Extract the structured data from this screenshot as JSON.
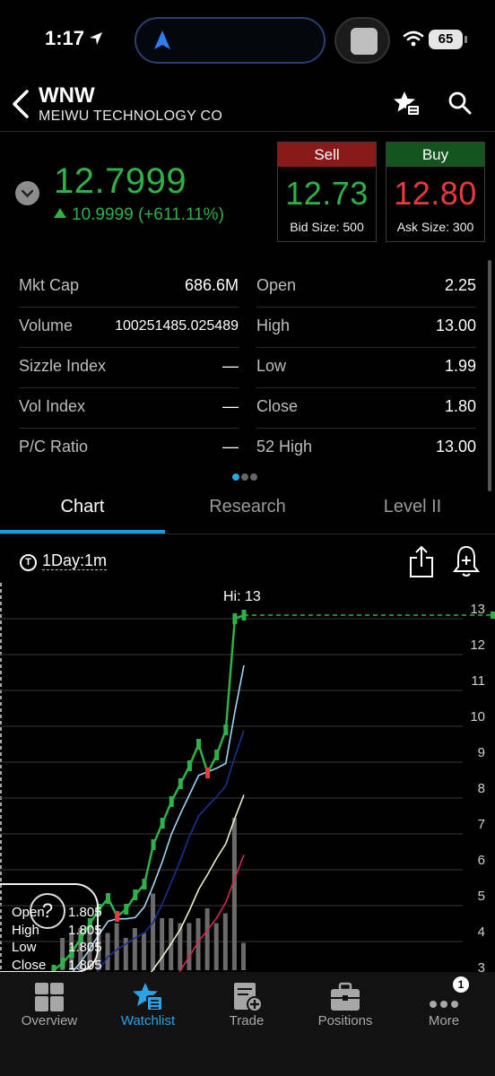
{
  "status_bar": {
    "time": "1:17",
    "battery": "65"
  },
  "header": {
    "ticker": "WNW",
    "company": "MEIWU TECHNOLOGY CO"
  },
  "quote": {
    "price": "12.7999",
    "change": "10.9999 (+611.11%)",
    "sell": {
      "label": "Sell",
      "price": "12.73",
      "size": "Bid Size: 500"
    },
    "buy": {
      "label": "Buy",
      "price": "12.80",
      "size": "Ask Size: 300"
    }
  },
  "stats": {
    "left": [
      {
        "label": "Mkt Cap",
        "value": "686.6M"
      },
      {
        "label": "Volume",
        "value": "100251485.025489"
      },
      {
        "label": "Sizzle Index",
        "value": "—"
      },
      {
        "label": "Vol Index",
        "value": "—"
      },
      {
        "label": "P/C Ratio",
        "value": "—"
      }
    ],
    "right": [
      {
        "label": "Open",
        "value": "2.25"
      },
      {
        "label": "High",
        "value": "13.00"
      },
      {
        "label": "Low",
        "value": "1.99"
      },
      {
        "label": "Close",
        "value": "1.80"
      },
      {
        "label": "52 High",
        "value": "13.00"
      }
    ]
  },
  "tabs": [
    "Chart",
    "Research",
    "Level II"
  ],
  "chart_toolbar": {
    "interval": "1Day:1m",
    "interval_badge": "T"
  },
  "chart_data": {
    "type": "line",
    "title": "",
    "hi_label": "Hi: 13",
    "ylim": [
      2.6,
      13.3
    ],
    "y_ticks": [
      "13",
      "12",
      "11",
      "10",
      "9",
      "8",
      "7",
      "6",
      "5",
      "4",
      "3"
    ],
    "last_price": 12.8,
    "series": [
      {
        "values": [
          2.9,
          3.1,
          3.4,
          3.8,
          4.2,
          4.6,
          4.9,
          4.4,
          4.6,
          5.0,
          5.3,
          6.4,
          7.0,
          7.6,
          8.1,
          8.6,
          9.2,
          8.4,
          8.9,
          9.6,
          12.7,
          12.8
        ],
        "color": "#2fb14a"
      }
    ],
    "ohlc": {
      "open_label": "Open",
      "open": "1.805",
      "high_label": "High",
      "high": "1.805",
      "low_label": "Low",
      "low": "1.805",
      "close_label": "Close",
      "close": "1.805"
    },
    "help_label": "?"
  },
  "bottom_nav": [
    {
      "label": "Overview",
      "icon": "overview-icon"
    },
    {
      "label": "Watchlist",
      "icon": "watchlist-icon"
    },
    {
      "label": "Trade",
      "icon": "trade-icon"
    },
    {
      "label": "Positions",
      "icon": "positions-icon"
    },
    {
      "label": "More",
      "icon": "more-icon"
    }
  ],
  "more_badge": "1",
  "colors": {
    "up": "#2fb14a",
    "down": "#e8393c",
    "accent": "#2aa3e8"
  }
}
